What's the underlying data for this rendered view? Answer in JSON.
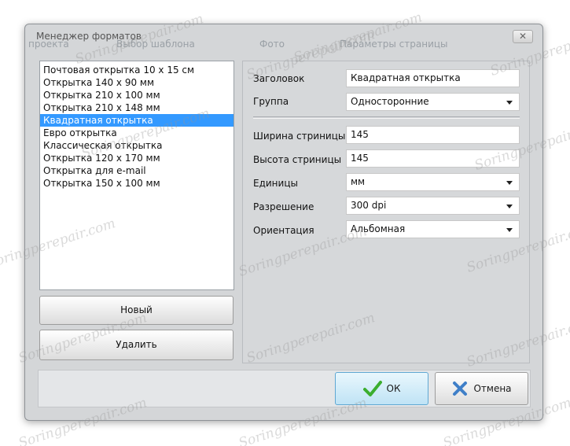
{
  "window": {
    "title": "Менеджер форматов",
    "close_glyph": "✕",
    "background_tabs": [
      "проекта",
      "Выбор шаблона",
      "Фото",
      "Параметры страницы"
    ]
  },
  "formats": {
    "items": [
      "Почтовая открытка 10 x 15 см",
      "Открытка 140 x 90 мм",
      "Открытка 210 x 100 мм",
      "Открытка 210 x 148 мм",
      "Квадратная открытка",
      "Евро открытка",
      "Классическая открытка",
      "Открытка 120 x 170 мм",
      "Открытка для e-mail",
      "Открытка 150 x 100 мм"
    ],
    "selected_index": 4
  },
  "buttons": {
    "new_label": "Новый",
    "delete_label": "Удалить",
    "ok_label": "ОК",
    "cancel_label": "Отмена"
  },
  "properties": {
    "title_label": "Заголовок",
    "title_value": "Квадратная открытка",
    "group_label": "Группа",
    "group_value": "Односторонние",
    "width_label": "Ширина стриницы",
    "width_value": "145",
    "height_label": "Высота стриницы",
    "height_value": "145",
    "units_label": "Единицы",
    "units_value": "мм",
    "resolution_label": "Разрешение",
    "resolution_value": "300 dpi",
    "orientation_label": "Ориентация",
    "orientation_value": "Альбомная"
  },
  "watermark": "Soringperepair.com",
  "colors": {
    "selection": "#3399ff",
    "ok_accent": "#5fa8d3",
    "check_green": "#3cae2f",
    "cancel_blue": "#3f7fc8"
  },
  "icons": {
    "ok": "check-icon",
    "cancel": "x-icon"
  }
}
